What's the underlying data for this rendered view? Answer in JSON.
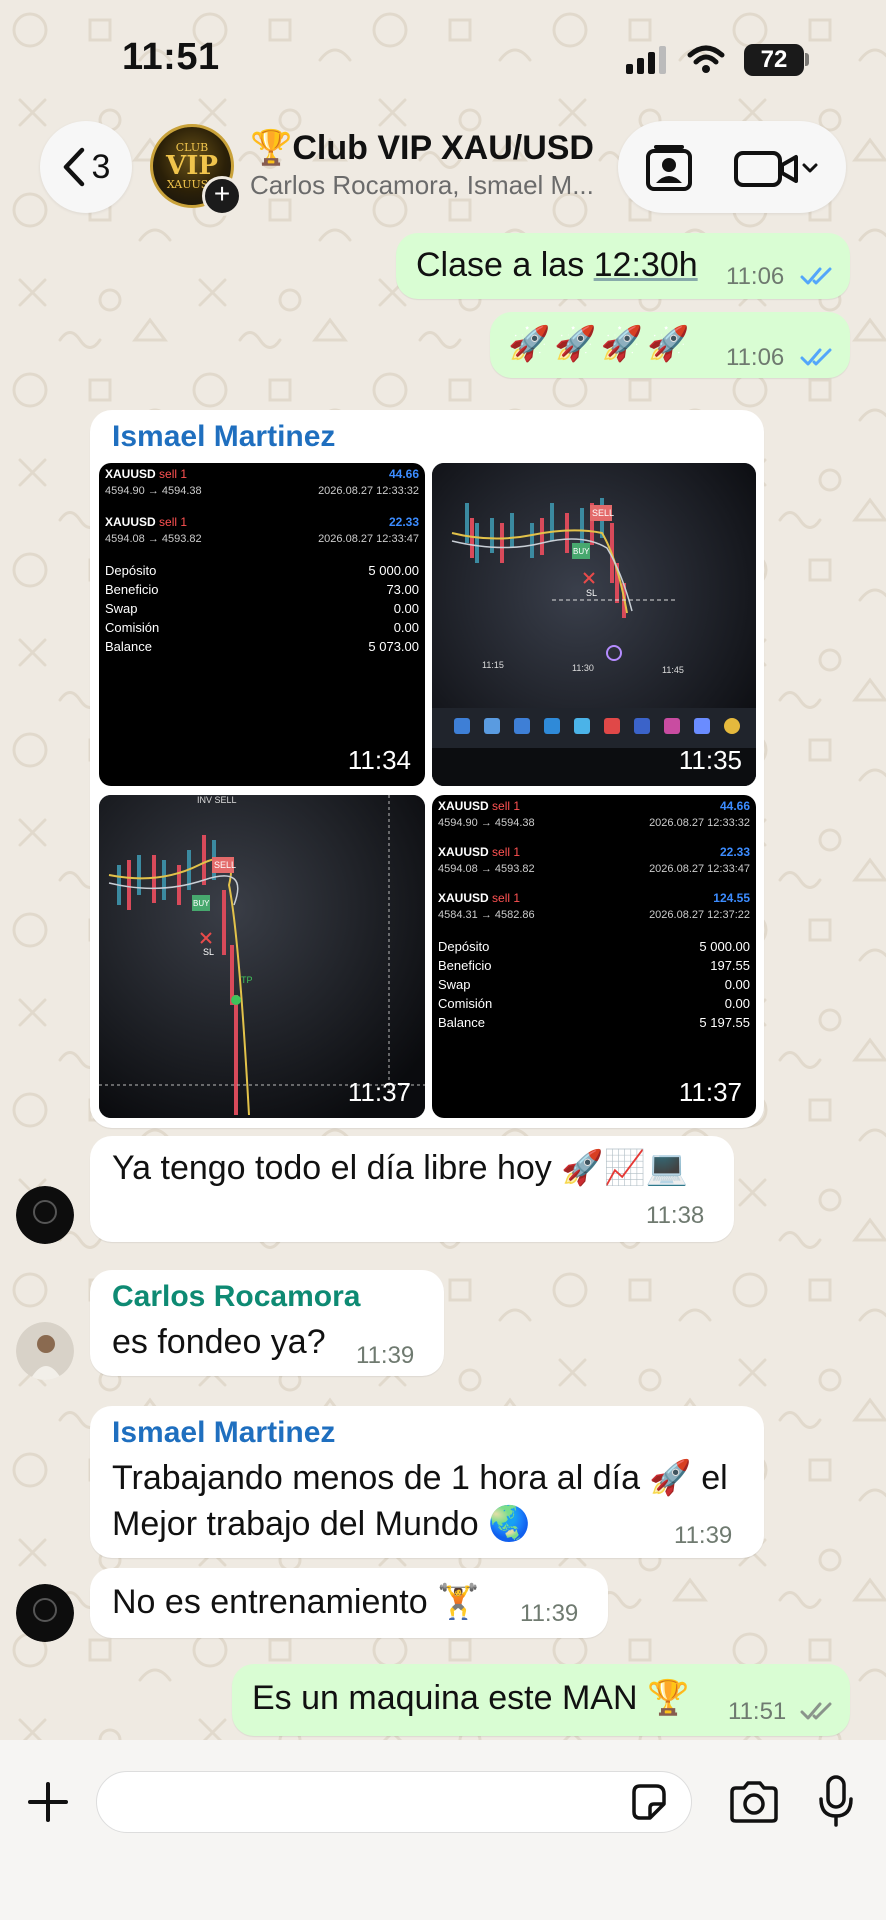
{
  "status_bar": {
    "time": "11:51",
    "battery": "72"
  },
  "header": {
    "back_count": "3",
    "avatar_text": {
      "line1": "CLUB",
      "line2": "VIP",
      "line3": "XAUUSD"
    },
    "title_emoji": "🏆",
    "title": "Club VIP XAU/USD",
    "subtitle": "Carlos Rocamora, Ismael M..."
  },
  "messages": {
    "m1": {
      "text_prefix": "Clase a las ",
      "text_link": "12:30h",
      "time": "11:06"
    },
    "m2": {
      "text": "🚀🚀🚀🚀",
      "time": "11:06"
    },
    "album": {
      "sender": "Ismael Martinez",
      "photos": [
        {
          "time": "11:34"
        },
        {
          "time": "11:35",
          "ticks": [
            "11:15",
            "11:30",
            "11:45"
          ],
          "labels": {
            "sell": "SELL",
            "buy": "BUY",
            "sl": "SL"
          }
        },
        {
          "time": "11:37",
          "labels": {
            "inv": "INV SELL",
            "sell": "SELL",
            "buy": "BUY",
            "sl": "SL",
            "tp": "TP"
          }
        },
        {
          "time": "11:37"
        }
      ],
      "report_a": {
        "trades": [
          {
            "sym": "XAUUSD",
            "side": "sell 1",
            "val": "44.66",
            "px": "4594.90 → 4594.38",
            "date": "2026.08.27 12:33:32"
          },
          {
            "sym": "XAUUSD",
            "side": "sell 1",
            "val": "22.33",
            "px": "4594.08 → 4593.82",
            "date": "2026.08.27 12:33:47"
          }
        ],
        "summary": [
          {
            "k": "Depósito",
            "v": "5 000.00"
          },
          {
            "k": "Beneficio",
            "v": "73.00"
          },
          {
            "k": "Swap",
            "v": "0.00"
          },
          {
            "k": "Comisión",
            "v": "0.00"
          },
          {
            "k": "Balance",
            "v": "5 073.00"
          }
        ]
      },
      "report_b": {
        "trades": [
          {
            "sym": "XAUUSD",
            "side": "sell 1",
            "val": "44.66",
            "px": "4594.90 → 4594.38",
            "date": "2026.08.27 12:33:32"
          },
          {
            "sym": "XAUUSD",
            "side": "sell 1",
            "val": "22.33",
            "px": "4594.08 → 4593.82",
            "date": "2026.08.27 12:33:47"
          },
          {
            "sym": "XAUUSD",
            "side": "sell 1",
            "val": "124.55",
            "px": "4584.31 → 4582.86",
            "date": "2026.08.27 12:37:22"
          }
        ],
        "summary": [
          {
            "k": "Depósito",
            "v": "5 000.00"
          },
          {
            "k": "Beneficio",
            "v": "197.55"
          },
          {
            "k": "Swap",
            "v": "0.00"
          },
          {
            "k": "Comisión",
            "v": "0.00"
          },
          {
            "k": "Balance",
            "v": "5 197.55"
          }
        ]
      }
    },
    "m3": {
      "text": "Ya tengo todo el día libre hoy 🚀📈💻",
      "time": "11:38"
    },
    "m4": {
      "sender": "Carlos Rocamora",
      "text": "es fondeo ya?",
      "time": "11:39"
    },
    "m5": {
      "sender": "Ismael Martinez",
      "line1": "Trabajando menos de 1 hora al día 🚀 el",
      "line2": "Mejor trabajo del Mundo 🌏",
      "time": "11:39"
    },
    "m6": {
      "text": "No es entrenamiento 🏋️",
      "time": "11:39"
    },
    "m7": {
      "text": "Es un maquina este MAN 🏆",
      "time": "11:51"
    }
  },
  "colors": {
    "outgoing": "#d9fdd3",
    "incoming": "#ffffff",
    "read_ticks": "#53a6fa",
    "delivered_ticks": "#8a948b",
    "sender_blue": "#1f6fbf",
    "sender_teal": "#0e8a73"
  },
  "icons": [
    "back-chevron-icon",
    "add-participant-icon",
    "contact-card-icon",
    "video-call-icon",
    "plus-icon",
    "sticker-icon",
    "camera-icon",
    "microphone-icon"
  ]
}
